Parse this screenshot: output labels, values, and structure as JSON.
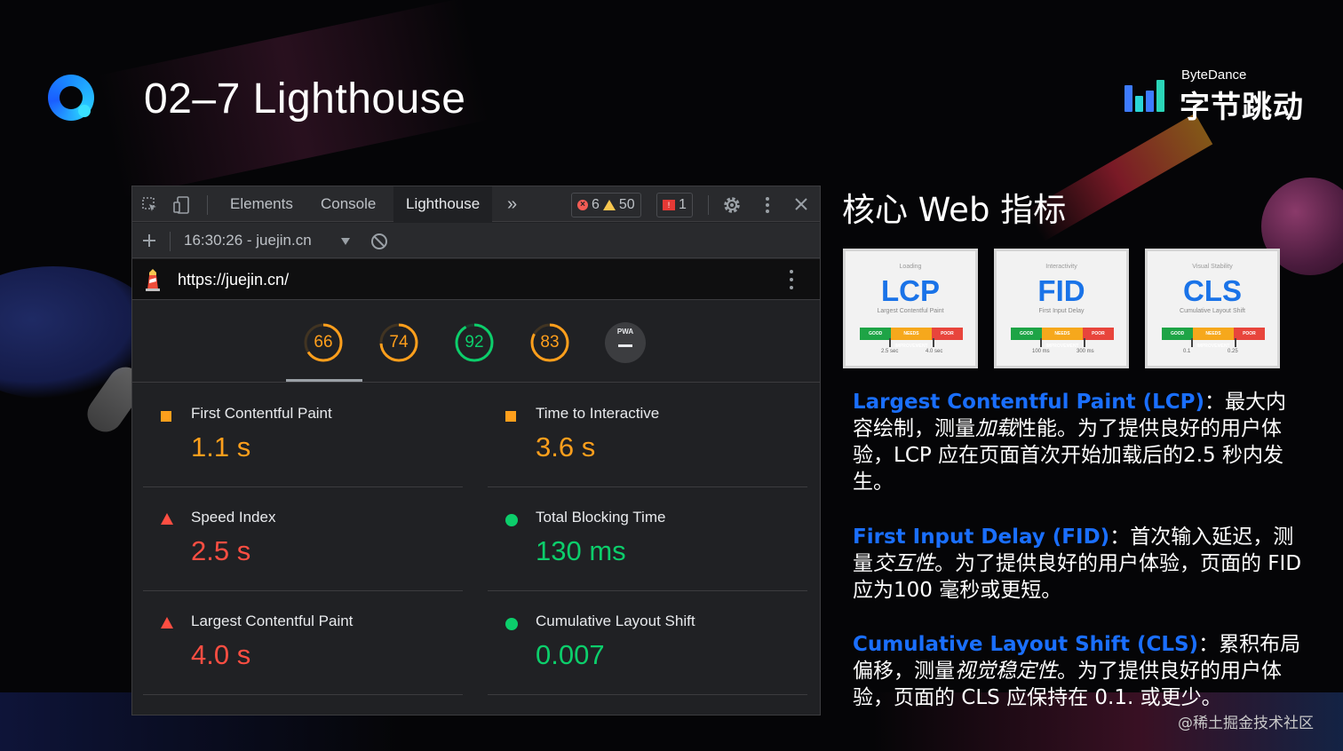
{
  "slide": {
    "title": "02–7 Lighthouse",
    "brand_en": "ByteDance",
    "brand_zh": "字节跳动",
    "watermark": "@稀土掘金技术社区"
  },
  "devtools": {
    "tabs": [
      "Elements",
      "Console",
      "Lighthouse"
    ],
    "active_tab": "Lighthouse",
    "more_tabs_glyph": "»",
    "error_count": "6",
    "warning_count": "50",
    "issue_count": "1",
    "report_selector": "16:30:26 - juejin.cn",
    "url": "https://juejin.cn/",
    "scores": [
      {
        "value": "66",
        "fraction": 0.66,
        "color": "#ff9f1c"
      },
      {
        "value": "74",
        "fraction": 0.74,
        "color": "#ff9f1c"
      },
      {
        "value": "92",
        "fraction": 0.92,
        "color": "#0cce6b"
      },
      {
        "value": "83",
        "fraction": 0.83,
        "color": "#ff9f1c"
      }
    ],
    "pwa_label": "PWA",
    "metrics": [
      {
        "label": "First Contentful Paint",
        "value": "1.1 s",
        "status": "average",
        "color": "#ff9f1c"
      },
      {
        "label": "Time to Interactive",
        "value": "3.6 s",
        "status": "average",
        "color": "#ff9f1c"
      },
      {
        "label": "Speed Index",
        "value": "2.5 s",
        "status": "fail",
        "color": "#ff4e42"
      },
      {
        "label": "Total Blocking Time",
        "value": "130 ms",
        "status": "pass",
        "color": "#0cce6b"
      },
      {
        "label": "Largest Contentful Paint",
        "value": "4.0 s",
        "status": "fail",
        "color": "#ff4e42"
      },
      {
        "label": "Cumulative Layout Shift",
        "value": "0.007",
        "status": "pass",
        "color": "#0cce6b"
      }
    ]
  },
  "core_web_vitals": {
    "title": "核心 Web 指标",
    "cards": [
      {
        "tag": "Loading",
        "abbr": "LCP",
        "sub": "Largest Contentful Paint",
        "tick_a": "2.5 sec",
        "tick_b": "4.0 sec"
      },
      {
        "tag": "Interactivity",
        "abbr": "FID",
        "sub": "First Input Delay",
        "tick_a": "100 ms",
        "tick_b": "300 ms"
      },
      {
        "tag": "Visual Stability",
        "abbr": "CLS",
        "sub": "Cumulative Layout Shift",
        "tick_a": "0.1",
        "tick_b": "0.25"
      }
    ],
    "scale_labels": {
      "good": "GOOD",
      "mid": "NEEDS IMPROVEMENT",
      "poor": "POOR"
    },
    "descriptions": [
      {
        "term": "Largest Contentful Paint (LCP)",
        "pre": "：最大内容绘制，测量",
        "emph": "加载",
        "post": "性能。为了提供良好的用户体验，LCP 应在页面首次开始加载后的2.5 秒内发生。"
      },
      {
        "term": "First Input Delay (FID)",
        "pre": "：首次输入延迟，测量",
        "emph": "交互性",
        "post": "。为了提供良好的用户体验，页面的 FID 应为100 毫秒或更短。"
      },
      {
        "term": "Cumulative Layout Shift (CLS)",
        "pre": "：累积布局偏移，测量",
        "emph": "视觉稳定性",
        "post": "。为了提供良好的用户体验，页面的 CLS 应保持在 0.1. 或更少。"
      }
    ]
  },
  "colors": {
    "accent_blue": "#1a6fff",
    "pass": "#0cce6b",
    "average": "#ff9f1c",
    "fail": "#ff4e42"
  }
}
